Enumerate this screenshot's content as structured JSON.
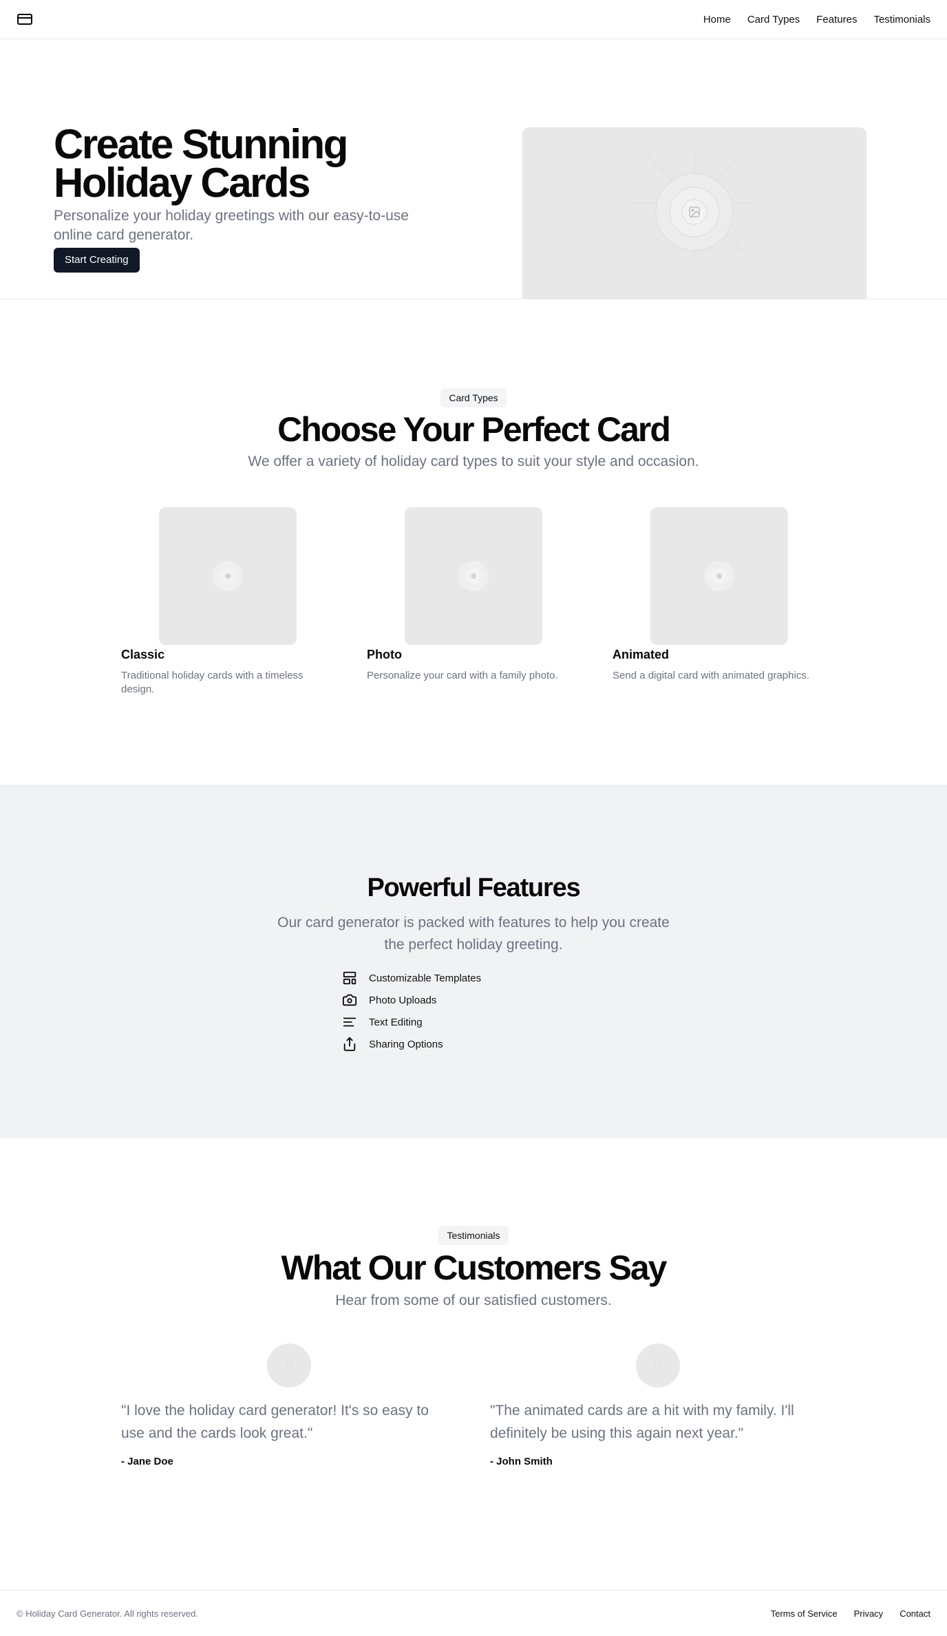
{
  "header": {
    "logo_icon": "credit-card-icon",
    "nav": [
      {
        "label": "Home"
      },
      {
        "label": "Card Types"
      },
      {
        "label": "Features"
      },
      {
        "label": "Testimonials"
      }
    ]
  },
  "hero": {
    "title_line1": "Create Stunning",
    "title_line2": "Holiday Cards",
    "subtitle": "Personalize your holiday greetings with our easy-to-use online card generator.",
    "cta_label": "Start Creating",
    "image_icon": "image-placeholder-icon"
  },
  "card_types": {
    "badge": "Card Types",
    "title": "Choose Your Perfect Card",
    "subtitle": "We offer a variety of holiday card types to suit your style and occasion.",
    "cards": [
      {
        "title": "Classic",
        "description": "Traditional holiday cards with a timeless design."
      },
      {
        "title": "Photo",
        "description": "Personalize your card with a family photo."
      },
      {
        "title": "Animated",
        "description": "Send a digital card with animated graphics."
      }
    ]
  },
  "features": {
    "title": "Powerful Features",
    "subtitle_line1": "Our card generator is packed with features to help you create",
    "subtitle_line2": "the perfect holiday greeting.",
    "items": [
      {
        "icon": "layout-template-icon",
        "label": "Customizable Templates"
      },
      {
        "icon": "camera-icon",
        "label": "Photo Uploads"
      },
      {
        "icon": "text-align-icon",
        "label": "Text Editing"
      },
      {
        "icon": "share-icon",
        "label": "Sharing Options"
      }
    ]
  },
  "testimonials": {
    "badge": "Testimonials",
    "title": "What Our Customers Say",
    "subtitle": "Hear from some of our satisfied customers.",
    "items": [
      {
        "quote": "\"I love the holiday card generator! It's so easy to use and the cards look great.\"",
        "author": "- Jane Doe"
      },
      {
        "quote": "\"The animated cards are a hit with my family. I'll definitely be using this again next year.\"",
        "author": "- John Smith"
      }
    ]
  },
  "footer": {
    "copyright": "© Holiday Card Generator. All rights reserved.",
    "links": [
      {
        "label": "Terms of Service"
      },
      {
        "label": "Privacy"
      },
      {
        "label": "Contact"
      }
    ]
  }
}
